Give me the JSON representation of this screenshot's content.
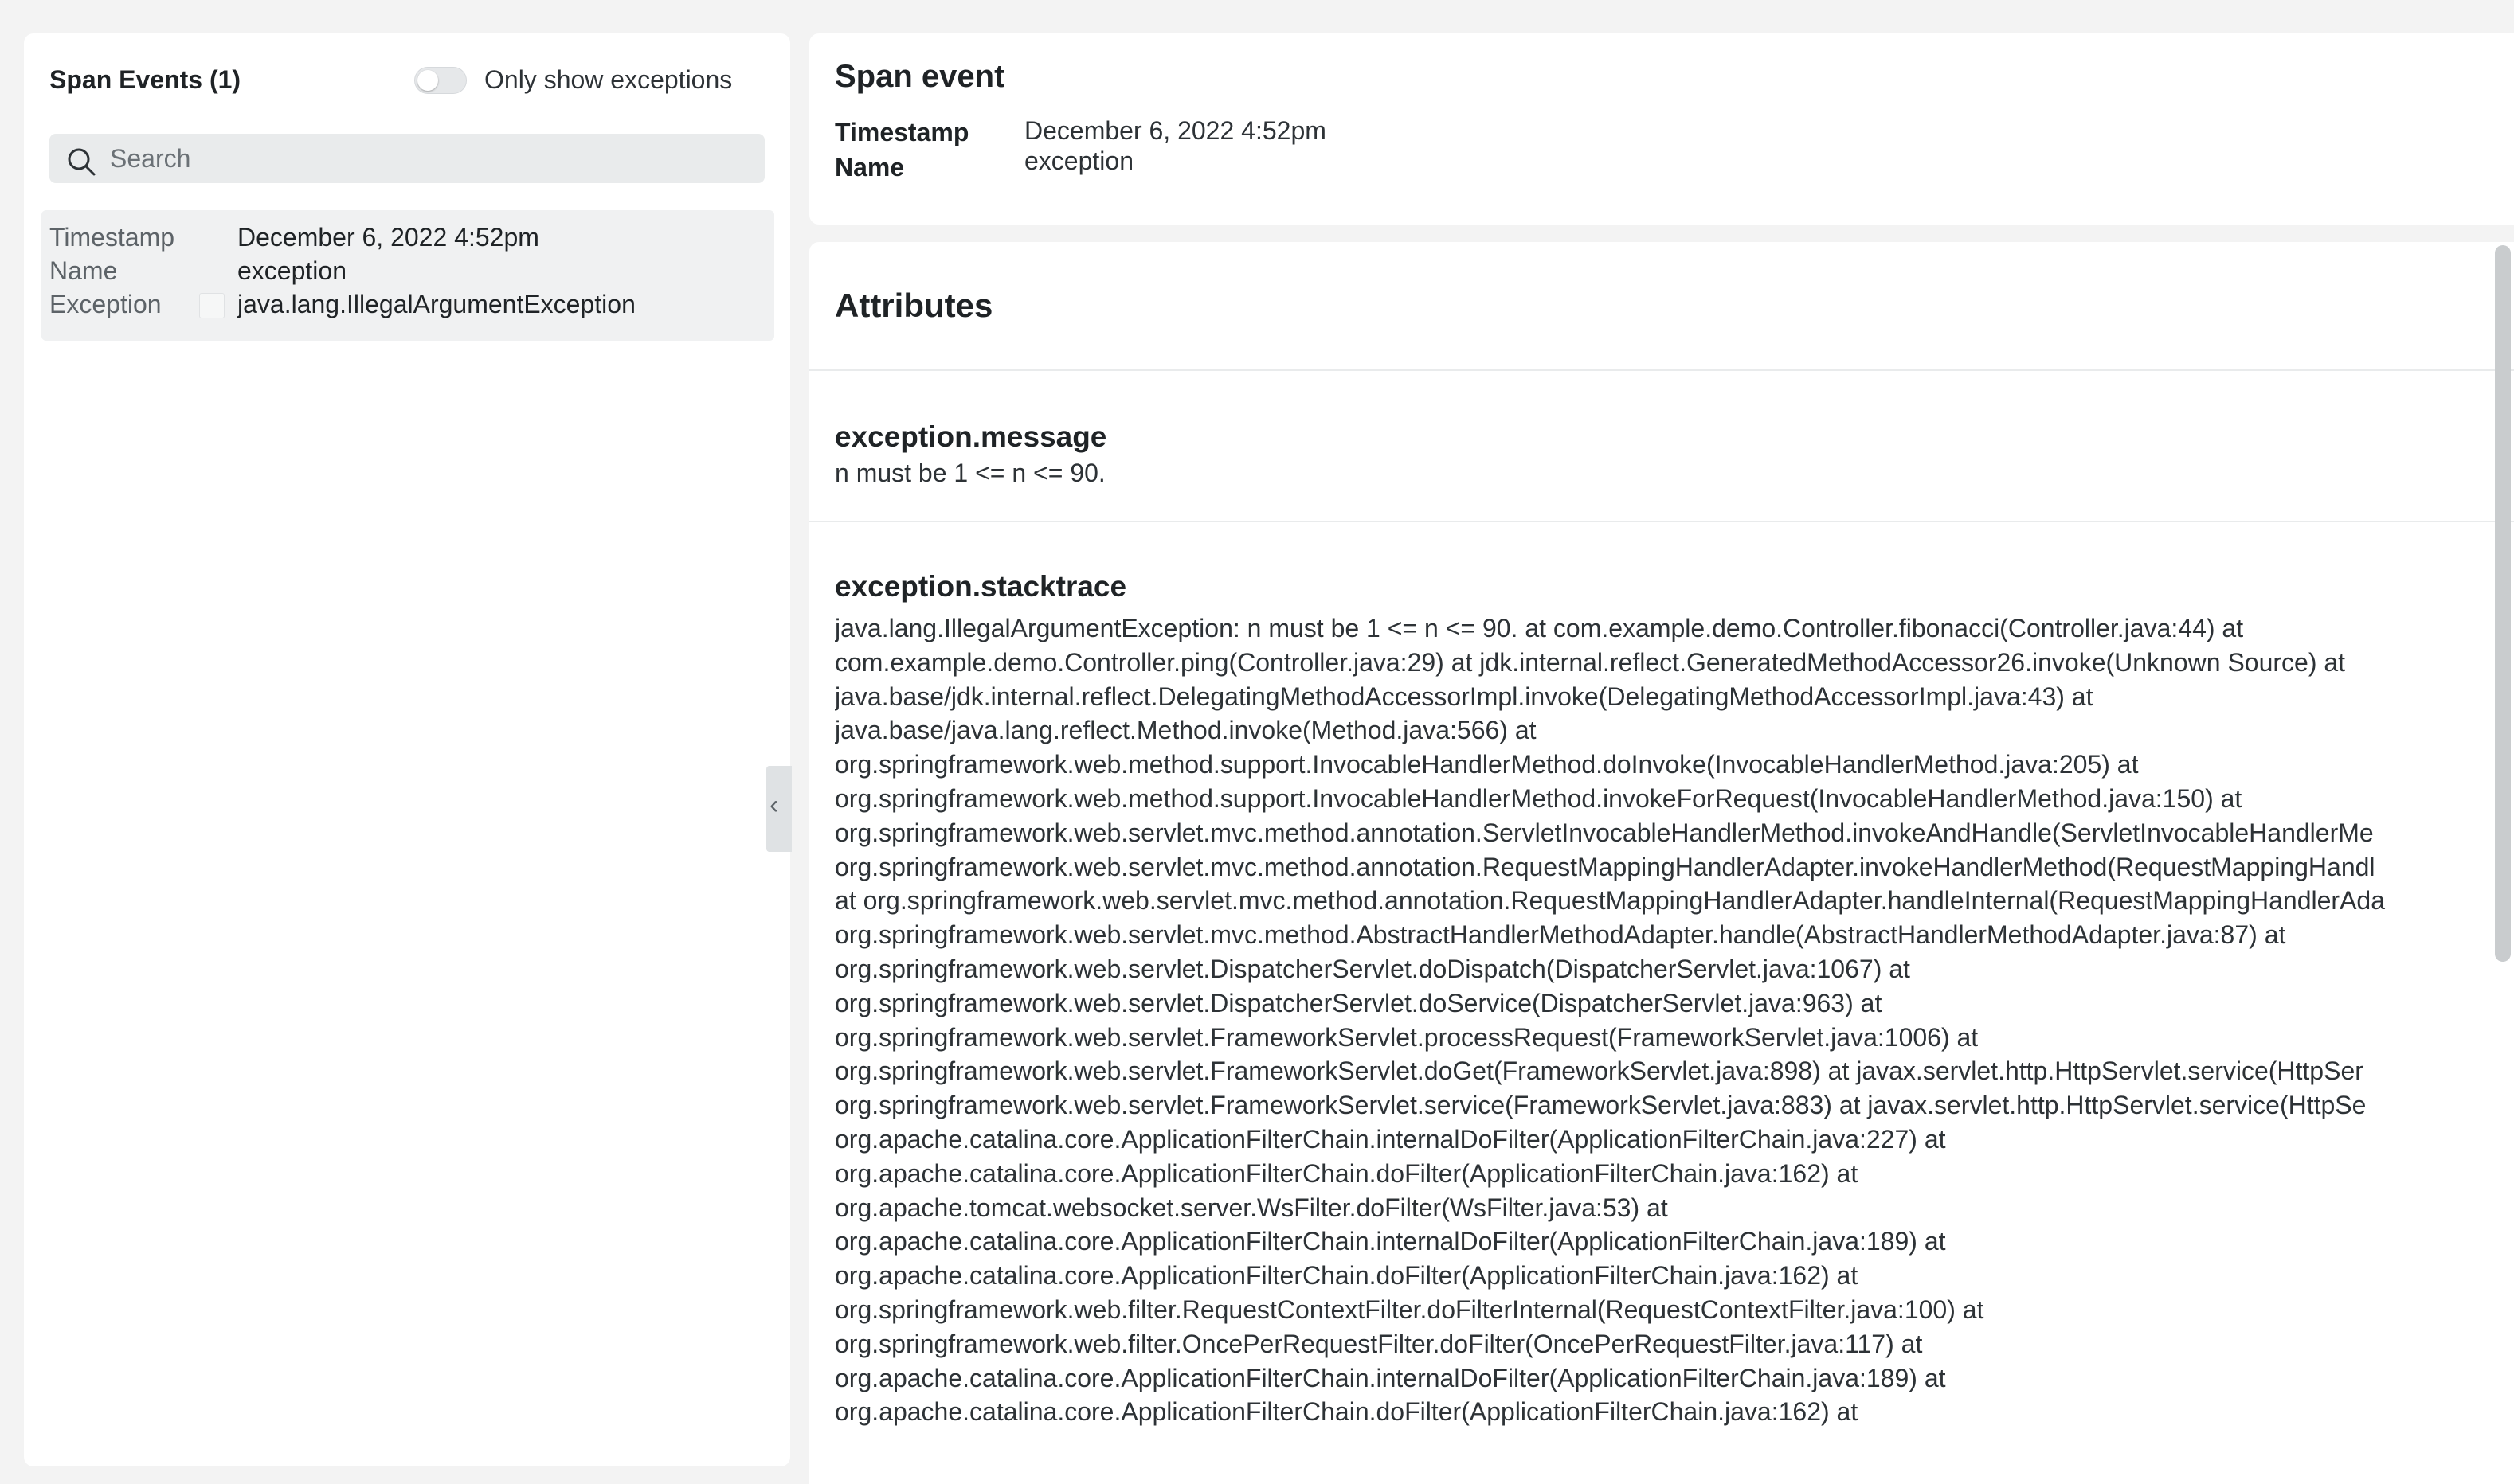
{
  "left_panel": {
    "title": "Span Events (1)",
    "toggle_label": "Only show exceptions",
    "toggle_on": false,
    "search_placeholder": "Search",
    "event": {
      "rows": [
        {
          "key": "Timestamp",
          "value": "December 6, 2022 4:52pm"
        },
        {
          "key": "Name",
          "value": "exception"
        },
        {
          "key": "Exception",
          "value": "java.lang.IllegalArgumentException"
        }
      ]
    },
    "collapse_glyph": "‹"
  },
  "span_event": {
    "title": "Span event",
    "timestamp_label": "Timestamp",
    "timestamp_value": "December 6, 2022 4:52pm",
    "name_label": "Name",
    "name_value": "exception"
  },
  "attributes": {
    "title": "Attributes",
    "message_key": "exception.message",
    "message_value": "n must be 1 <= n <= 90.",
    "stacktrace_key": "exception.stacktrace",
    "stacktrace_lines": [
      "java.lang.IllegalArgumentException: n must be 1 <= n <= 90. at com.example.demo.Controller.fibonacci(Controller.java:44) at",
      "com.example.demo.Controller.ping(Controller.java:29) at jdk.internal.reflect.GeneratedMethodAccessor26.invoke(Unknown Source) at",
      "java.base/jdk.internal.reflect.DelegatingMethodAccessorImpl.invoke(DelegatingMethodAccessorImpl.java:43) at",
      "java.base/java.lang.reflect.Method.invoke(Method.java:566) at",
      "org.springframework.web.method.support.InvocableHandlerMethod.doInvoke(InvocableHandlerMethod.java:205) at",
      "org.springframework.web.method.support.InvocableHandlerMethod.invokeForRequest(InvocableHandlerMethod.java:150) at",
      "org.springframework.web.servlet.mvc.method.annotation.ServletInvocableHandlerMethod.invokeAndHandle(ServletInvocableHandlerMe",
      "org.springframework.web.servlet.mvc.method.annotation.RequestMappingHandlerAdapter.invokeHandlerMethod(RequestMappingHandl",
      "at org.springframework.web.servlet.mvc.method.annotation.RequestMappingHandlerAdapter.handleInternal(RequestMappingHandlerAda",
      "org.springframework.web.servlet.mvc.method.AbstractHandlerMethodAdapter.handle(AbstractHandlerMethodAdapter.java:87) at",
      "org.springframework.web.servlet.DispatcherServlet.doDispatch(DispatcherServlet.java:1067) at",
      "org.springframework.web.servlet.DispatcherServlet.doService(DispatcherServlet.java:963) at",
      "org.springframework.web.servlet.FrameworkServlet.processRequest(FrameworkServlet.java:1006) at",
      "org.springframework.web.servlet.FrameworkServlet.doGet(FrameworkServlet.java:898) at javax.servlet.http.HttpServlet.service(HttpSer",
      "org.springframework.web.servlet.FrameworkServlet.service(FrameworkServlet.java:883) at javax.servlet.http.HttpServlet.service(HttpSe",
      "org.apache.catalina.core.ApplicationFilterChain.internalDoFilter(ApplicationFilterChain.java:227) at",
      "org.apache.catalina.core.ApplicationFilterChain.doFilter(ApplicationFilterChain.java:162) at",
      "org.apache.tomcat.websocket.server.WsFilter.doFilter(WsFilter.java:53) at",
      "org.apache.catalina.core.ApplicationFilterChain.internalDoFilter(ApplicationFilterChain.java:189) at",
      "org.apache.catalina.core.ApplicationFilterChain.doFilter(ApplicationFilterChain.java:162) at",
      "org.springframework.web.filter.RequestContextFilter.doFilterInternal(RequestContextFilter.java:100) at",
      "org.springframework.web.filter.OncePerRequestFilter.doFilter(OncePerRequestFilter.java:117) at",
      "org.apache.catalina.core.ApplicationFilterChain.internalDoFilter(ApplicationFilterChain.java:189) at",
      "org.apache.catalina.core.ApplicationFilterChain.doFilter(ApplicationFilterChain.java:162) at"
    ]
  }
}
